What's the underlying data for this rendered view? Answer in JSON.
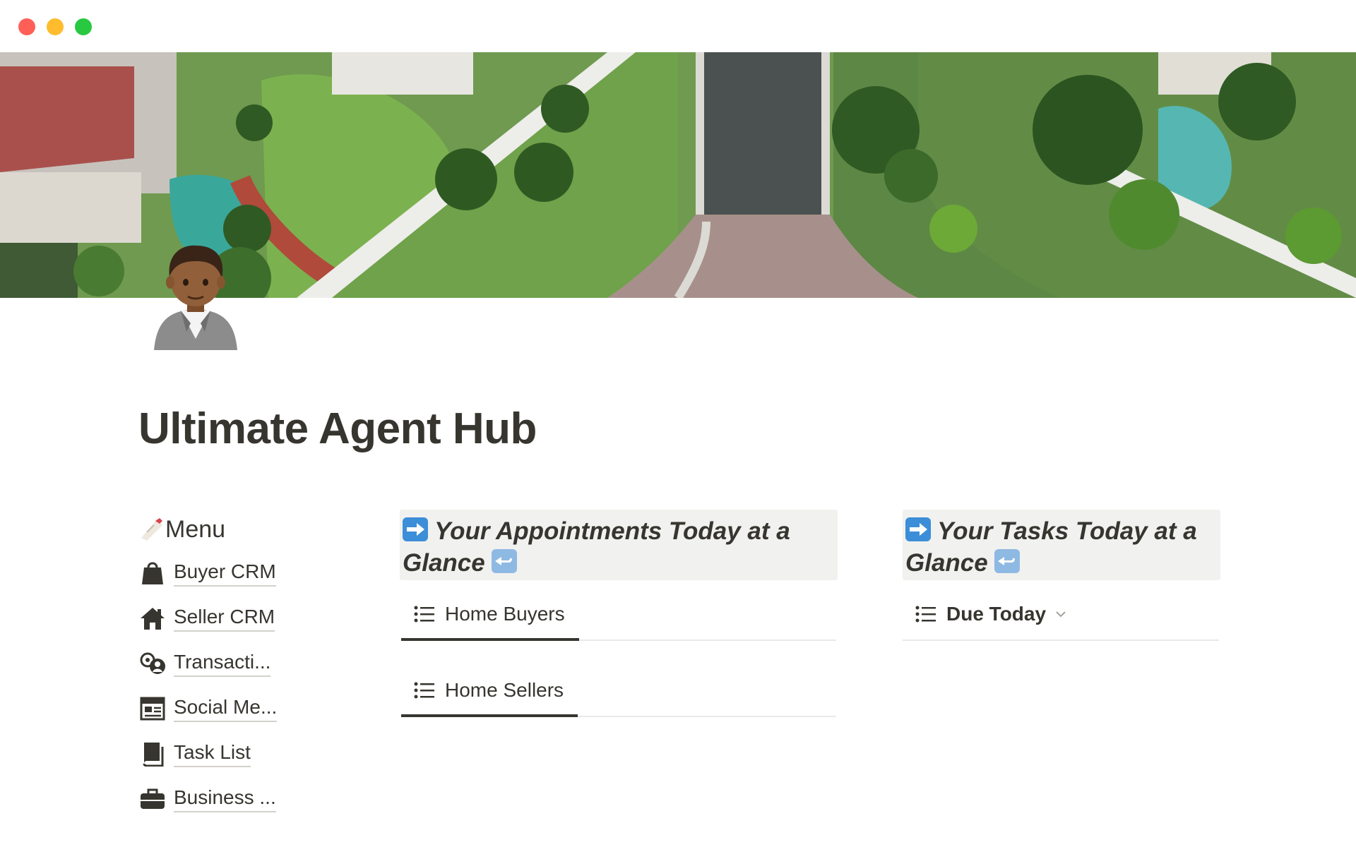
{
  "page": {
    "title": "Ultimate Agent Hub"
  },
  "menu": {
    "heading": "Menu",
    "heading_icon": "memo-icon",
    "items": [
      {
        "label": "Buyer CRM",
        "icon": "shopping-bag-icon"
      },
      {
        "label": "Seller CRM",
        "icon": "home-icon"
      },
      {
        "label": "Transacti...",
        "icon": "user-gear-icon"
      },
      {
        "label": "Social Me...",
        "icon": "newspaper-icon"
      },
      {
        "label": "Task List",
        "icon": "book-icon"
      },
      {
        "label": "Business ...",
        "icon": "briefcase-icon"
      }
    ]
  },
  "appointments": {
    "callout_line1": "Your Appointments Today at a",
    "callout_line2": "Glance",
    "views": [
      {
        "label": "Home Buyers",
        "icon": "list-icon"
      },
      {
        "label": "Home Sellers",
        "icon": "list-icon"
      }
    ]
  },
  "tasks": {
    "callout_line1": "Your Tasks Today at a",
    "callout_line2": "Glance",
    "views": [
      {
        "label": "Due Today",
        "icon": "list-icon",
        "dropdown_icon": "chevron-down-icon"
      }
    ]
  },
  "colors": {
    "text": "#37352f",
    "callout_bg": "#f1f1ef",
    "emoji_blue": "#3c8ed8"
  }
}
